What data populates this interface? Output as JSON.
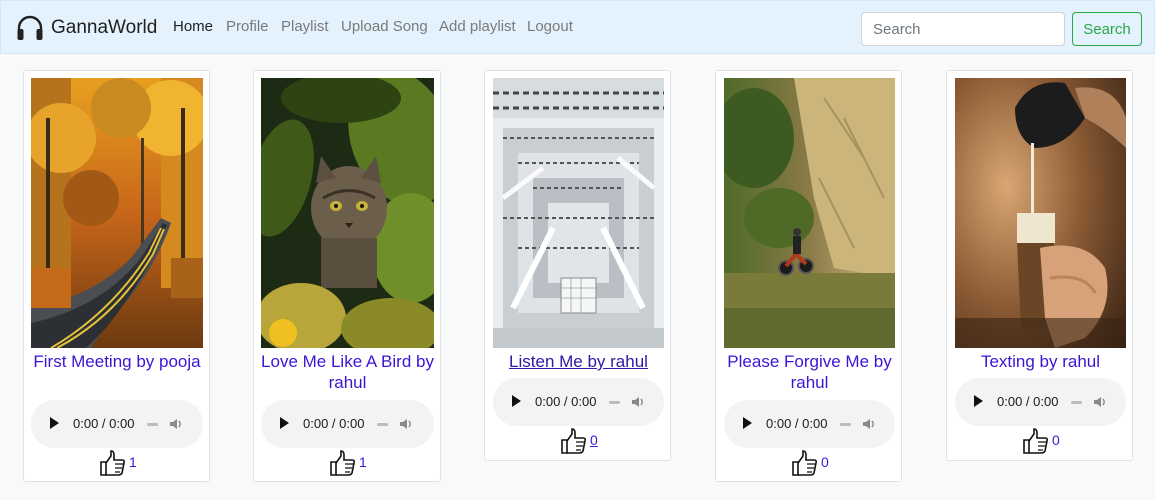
{
  "brand": {
    "name": "GannaWorld",
    "logo_icon": "headphones-icon"
  },
  "nav": [
    {
      "label": "Home",
      "active": true
    },
    {
      "label": "Profile",
      "active": false
    },
    {
      "label": "Playlist",
      "active": false
    },
    {
      "label": "Upload Song",
      "active": false
    },
    {
      "label": "Add playlist",
      "active": false
    },
    {
      "label": "Logout",
      "active": false
    }
  ],
  "search": {
    "placeholder": "Search",
    "value": "",
    "button_label": "Search"
  },
  "colors": {
    "navbar_bg": "#e3f2fd",
    "link": "#3d14d6",
    "search_button": "#28a745",
    "page_bg": "#f8f9fa"
  },
  "songs": [
    {
      "title": "First Meeting by pooja",
      "image": "autumn-road",
      "time": "0:00 / 0:00",
      "likes": "1"
    },
    {
      "title": "Love Me Like A Bird by rahul",
      "image": "cat-in-leaves",
      "time": "0:00 / 0:00",
      "likes": "1"
    },
    {
      "title": "Listen Me by rahul",
      "image": "library-atrium",
      "time": "0:00 / 0:00",
      "likes": "0"
    },
    {
      "title": "Please Forgive Me by rahul",
      "image": "motorcycle-cliff",
      "time": "0:00 / 0:00",
      "likes": "0"
    },
    {
      "title": "Texting by rahul",
      "image": "coffee-pour",
      "time": "0:00 / 0:00",
      "likes": "0"
    }
  ]
}
